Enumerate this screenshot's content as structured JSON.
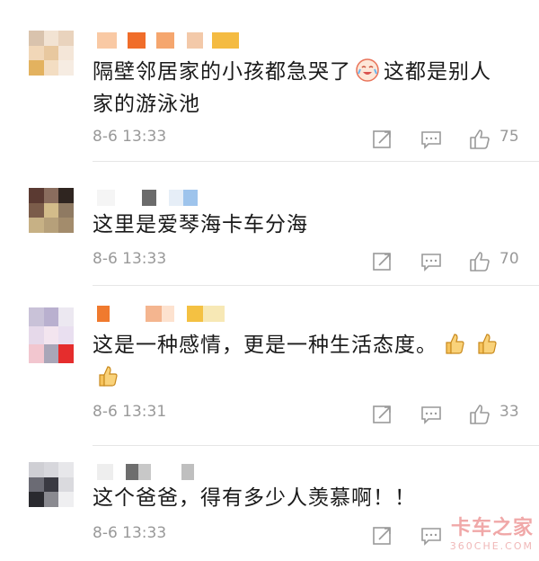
{
  "comments": [
    {
      "text_lines": [
        "隔壁邻居家的小孩都急哭了",
        "这都是别人",
        "家的游泳池"
      ],
      "emoji": "laughing-cry-emoji",
      "time": "8-6 13:33",
      "likes": "75"
    },
    {
      "text_lines": [
        "这里是爱琴海卡车分海"
      ],
      "time": "8-6 13:33",
      "likes": "70"
    },
    {
      "text_lines": [
        "这是一种感情，更是一种生活态度。"
      ],
      "emoji": "thumbs-up-emoji",
      "time": "8-6 13:31",
      "likes": "33"
    },
    {
      "text_lines": [
        "这个爸爸，得有多少人羡慕啊！！"
      ],
      "time": "8-6 13:33",
      "likes": ""
    }
  ],
  "watermark": {
    "main": "卡车之家",
    "sub": "360CHE.COM"
  },
  "colors": {
    "text": "#1a1a1a",
    "meta": "#999999",
    "divider": "#e6e6e6"
  },
  "icons": [
    "repost-icon",
    "comment-icon",
    "like-icon"
  ]
}
